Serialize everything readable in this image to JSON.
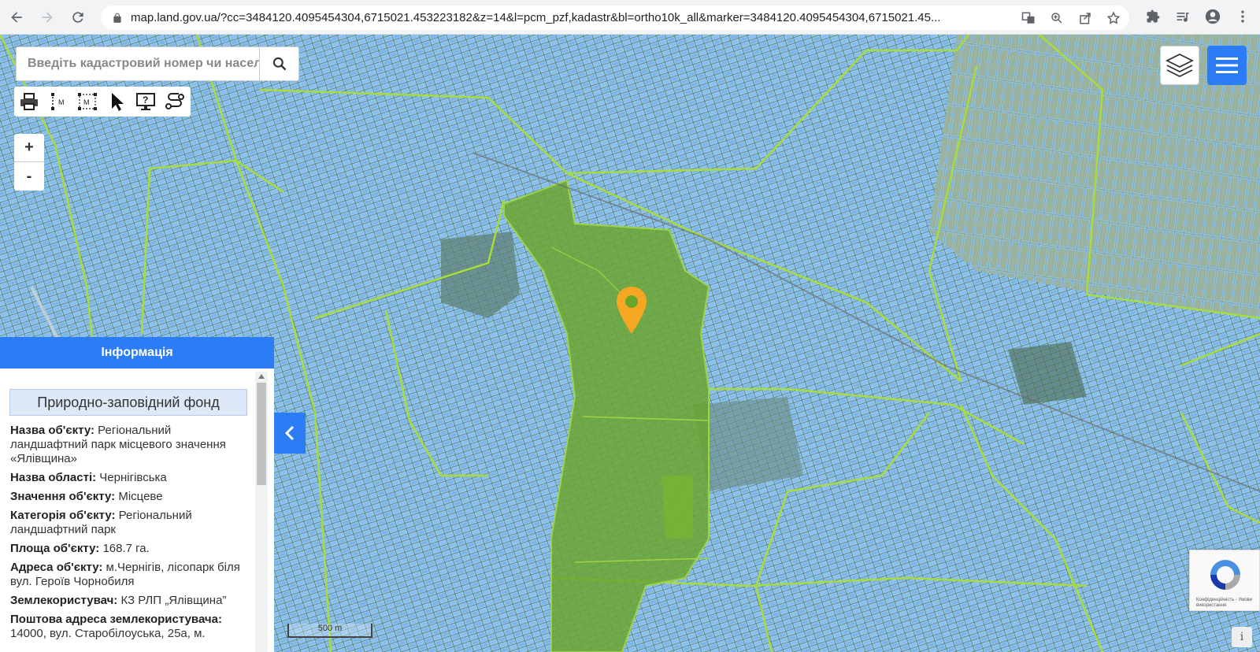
{
  "browser": {
    "url": "map.land.gov.ua/?cc=3484120.4095454304,6715021.453223182&z=14&l=pcm_pzf,kadastr&bl=ortho10k_all&marker=3484120.4095454304,6715021.45..."
  },
  "search": {
    "placeholder": "Введіть кадастровий номер чи насел"
  },
  "zoom": {
    "in_label": "+",
    "out_label": "-"
  },
  "info_panel": {
    "header": "Інформація",
    "title": "Природно-заповідний фонд",
    "fields": [
      {
        "label": "Назва об'єкту:",
        "value": "Регіональний ландшафтний парк місцевого значення «Ялівщина»"
      },
      {
        "label": "Назва області:",
        "value": "Чернігівська"
      },
      {
        "label": "Значення об'єкту:",
        "value": "Місцеве"
      },
      {
        "label": "Категорія об'єкту:",
        "value": "Регіональний ландшафтний парк"
      },
      {
        "label": "Площа об'єкту:",
        "value": "168.7 га."
      },
      {
        "label": "Адреса об'єкту:",
        "value": "м.Чернігів, лісопарк біля вул. Героїв Чорнобиля"
      },
      {
        "label": "Землекористувач:",
        "value": "КЗ РЛП „Ялівщина”"
      },
      {
        "label": "Поштова адреса землекористувача:",
        "value": "14000, вул. Старобілоуська, 25а, м."
      }
    ]
  },
  "scale": {
    "label": "500 m"
  },
  "recaptcha": {
    "text": "Конфіденційність - Умови використання"
  },
  "colors": {
    "accent": "#2c7cf6",
    "parcel": "#7fb8f0",
    "park": "#6aa52a",
    "marker": "#f5a623"
  }
}
